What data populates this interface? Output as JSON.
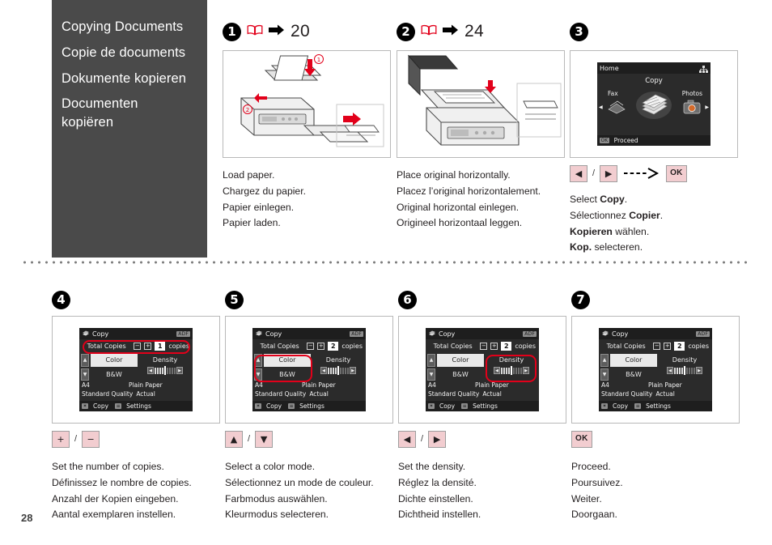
{
  "title_panel": {
    "lines": [
      "Copying Documents",
      "Copie de documents",
      "Dokumente kopieren",
      "Documenten kopiëren"
    ]
  },
  "steps_row1": [
    {
      "number": "1",
      "book_icon": "open-book-icon",
      "arrow_icon": "right-arrow-icon",
      "page_ref": "20",
      "illustration": "printer-load-paper-illustration",
      "caption": [
        {
          "text": "Load paper."
        },
        {
          "text": "Chargez du papier."
        },
        {
          "text": "Papier einlegen."
        },
        {
          "text": "Papier laden."
        }
      ]
    },
    {
      "number": "2",
      "book_icon": "open-book-icon",
      "arrow_icon": "right-arrow-icon",
      "page_ref": "24",
      "illustration": "printer-place-original-illustration",
      "caption": [
        {
          "text": "Place original horizontally."
        },
        {
          "text": "Placez l’original horizontalement."
        },
        {
          "text": "Original horizontal einlegen."
        },
        {
          "text": "Origineel horizontaal leggen."
        }
      ]
    },
    {
      "number": "3",
      "illustration": "lcd-home-screen",
      "lcd_home": {
        "breadcrumb": "Home",
        "network_icon": "network-icon",
        "selected_label": "Copy",
        "left_label": "Fax",
        "right_label": "Photos",
        "left_arrow_icon": "left-arrow-icon",
        "right_arrow_icon": "right-arrow-icon",
        "footer_key": "OK",
        "footer_label": "Proceed"
      },
      "keys": [
        {
          "glyph": "◀",
          "name": "left-arrow-key"
        },
        {
          "separator": "/"
        },
        {
          "glyph": "▶",
          "name": "right-arrow-key"
        },
        {
          "dashed_arrow": true
        },
        {
          "glyph": "OK",
          "name": "ok-key"
        }
      ],
      "caption": [
        {
          "pre": "Select ",
          "bold": "Copy",
          "post": "."
        },
        {
          "pre": "Sélectionnez ",
          "bold": "Copier",
          "post": "."
        },
        {
          "pre": "",
          "bold": "Kopieren",
          "post": " wählen."
        },
        {
          "pre": "",
          "bold": "Kop.",
          "post": " selecteren."
        }
      ]
    }
  ],
  "steps_row2": [
    {
      "number": "4",
      "lcd": {
        "title": "Copy",
        "title_icon": "copy-stack-icon",
        "adf_badge": "ADF",
        "copies_label": "Total Copies",
        "minus": "−",
        "plus": "+",
        "copies_value": "1",
        "copies_unit": "copies",
        "mode_selected": "Color",
        "mode_other": "B&W",
        "density_label": "Density",
        "paper_size": "A4",
        "paper_type": "Plain Paper",
        "quality": "Standard Quality",
        "layout": "Actual",
        "footer_key1": "✶",
        "footer_label1": "Copy",
        "footer_key2": "≡",
        "footer_label2": "Settings"
      },
      "highlight": "copies",
      "keys": [
        {
          "glyph": "+",
          "name": "plus-key"
        },
        {
          "separator": "/"
        },
        {
          "glyph": "−",
          "name": "minus-key"
        }
      ],
      "caption": [
        {
          "text": "Set the number of copies."
        },
        {
          "text": "Définissez le nombre de copies."
        },
        {
          "text": "Anzahl der Kopien eingeben."
        },
        {
          "text": "Aantal exemplaren instellen."
        }
      ]
    },
    {
      "number": "5",
      "lcd": {
        "title": "Copy",
        "title_icon": "copy-stack-icon",
        "adf_badge": "ADF",
        "copies_label": "Total Copies",
        "minus": "−",
        "plus": "+",
        "copies_value": "2",
        "copies_unit": "copies",
        "mode_selected": "Color",
        "mode_other": "B&W",
        "density_label": "Density",
        "paper_size": "A4",
        "paper_type": "Plain Paper",
        "quality": "Standard Quality",
        "layout": "Actual",
        "footer_key1": "✶",
        "footer_label1": "Copy",
        "footer_key2": "≡",
        "footer_label2": "Settings"
      },
      "highlight": "mode",
      "keys": [
        {
          "glyph": "▲",
          "name": "up-arrow-key"
        },
        {
          "separator": "/"
        },
        {
          "glyph": "▼",
          "name": "down-arrow-key"
        }
      ],
      "caption": [
        {
          "text": "Select a color mode."
        },
        {
          "text": "Sélectionnez un mode de couleur."
        },
        {
          "text": "Farbmodus auswählen."
        },
        {
          "text": "Kleurmodus selecteren."
        }
      ]
    },
    {
      "number": "6",
      "lcd": {
        "title": "Copy",
        "title_icon": "copy-stack-icon",
        "adf_badge": "ADF",
        "copies_label": "Total Copies",
        "minus": "−",
        "plus": "+",
        "copies_value": "2",
        "copies_unit": "copies",
        "mode_selected": "Color",
        "mode_other": "B&W",
        "density_label": "Density",
        "paper_size": "A4",
        "paper_type": "Plain Paper",
        "quality": "Standard Quality",
        "layout": "Actual",
        "footer_key1": "✶",
        "footer_label1": "Copy",
        "footer_key2": "≡",
        "footer_label2": "Settings"
      },
      "highlight": "density",
      "keys": [
        {
          "glyph": "◀",
          "name": "left-arrow-key"
        },
        {
          "separator": "/"
        },
        {
          "glyph": "▶",
          "name": "right-arrow-key"
        }
      ],
      "caption": [
        {
          "text": "Set the density."
        },
        {
          "text": "Réglez la densité."
        },
        {
          "text": "Dichte einstellen."
        },
        {
          "text": "Dichtheid instellen."
        }
      ]
    },
    {
      "number": "7",
      "lcd": {
        "title": "Copy",
        "title_icon": "copy-stack-icon",
        "adf_badge": "ADF",
        "copies_label": "Total Copies",
        "minus": "−",
        "plus": "+",
        "copies_value": "2",
        "copies_unit": "copies",
        "mode_selected": "Color",
        "mode_other": "B&W",
        "density_label": "Density",
        "paper_size": "A4",
        "paper_type": "Plain Paper",
        "quality": "Standard Quality",
        "layout": "Actual",
        "footer_key1": "✶",
        "footer_label1": "Copy",
        "footer_key2": "≡",
        "footer_label2": "Settings"
      },
      "highlight": "none",
      "keys": [
        {
          "glyph": "OK",
          "name": "ok-key"
        }
      ],
      "caption": [
        {
          "text": "Proceed."
        },
        {
          "text": "Poursuivez."
        },
        {
          "text": "Weiter."
        },
        {
          "text": "Doorgaan."
        }
      ]
    }
  ],
  "page_number": "28",
  "colors": {
    "panel_bg": "#4a4a4a",
    "key_bg": "#f2cdd0",
    "highlight_red": "#e2001a",
    "book_red": "#e2001a"
  }
}
